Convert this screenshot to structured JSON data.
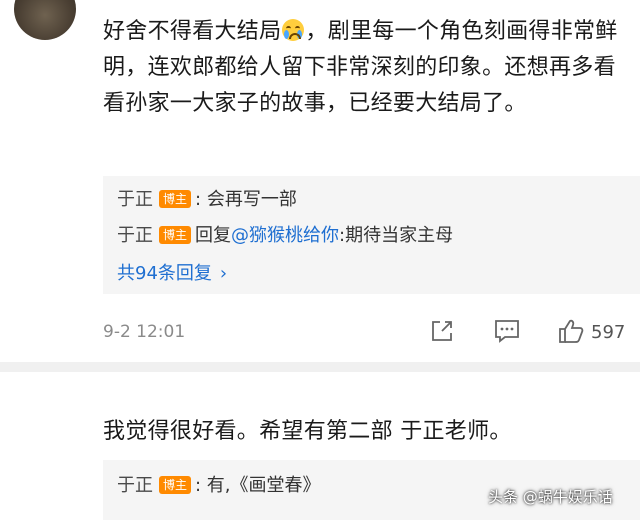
{
  "comments": [
    {
      "text_before_emoji": "好舍不得看大结局",
      "emoji": "crying-face-icon",
      "text_after_emoji": "，剧里每一个角色刻画得非常鲜明，连欢郎都给人留下非常深刻的印象。还想再多看看孙家一大家子的故事，已经要大结局了。",
      "replies": [
        {
          "author": "于正",
          "badge": "博主",
          "prefix": ":",
          "mention": "",
          "text": " 会再写一部"
        },
        {
          "author": "于正",
          "badge": "博主",
          "prefix": "回复",
          "mention": "@猕猴桃给你",
          "text": ":期待当家主母"
        }
      ],
      "more_replies": "共94条回复",
      "timestamp": "9-2 12:01",
      "like_count": "597"
    },
    {
      "text": "我觉得很好看。希望有第二部 于正老师。",
      "replies": [
        {
          "author": "于正",
          "badge": "博主",
          "text": ": 有,《画堂春》"
        }
      ]
    }
  ],
  "watermark": "头条 @蜗牛娱乐话",
  "colors": {
    "badge": "#ff8a00",
    "link": "#1f6fd1",
    "reply_bg": "#f5f5f5"
  }
}
